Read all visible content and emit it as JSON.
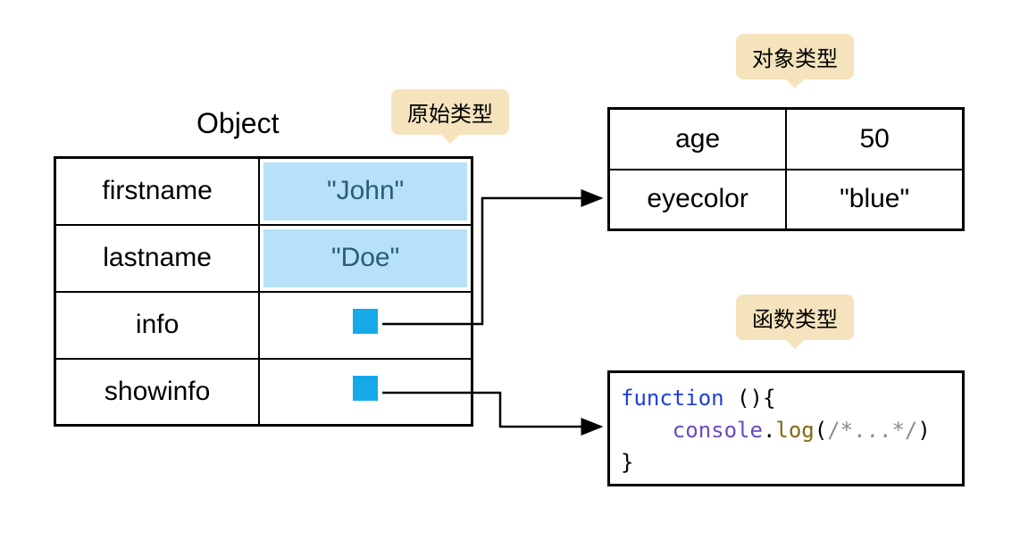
{
  "title": "Object",
  "labels": {
    "primitive": "原始类型",
    "object": "对象类型",
    "function": "函数类型"
  },
  "object_table": [
    {
      "key": "firstname",
      "value": "\"John\"",
      "type": "primitive"
    },
    {
      "key": "lastname",
      "value": "\"Doe\"",
      "type": "primitive"
    },
    {
      "key": "info",
      "value": null,
      "type": "reference"
    },
    {
      "key": "showinfo",
      "value": null,
      "type": "reference"
    }
  ],
  "referenced_object": [
    {
      "key": "age",
      "value": "50"
    },
    {
      "key": "eyecolor",
      "value": "\"blue\""
    }
  ],
  "code": {
    "line1_kw": "function",
    "line1_rest": " (){",
    "line2_indent": "    ",
    "line2_obj": "console",
    "line2_dot": ".",
    "line2_method": "log",
    "line2_open": "(",
    "line2_comment": "/*...*/",
    "line2_close": ")",
    "line3": "}"
  }
}
